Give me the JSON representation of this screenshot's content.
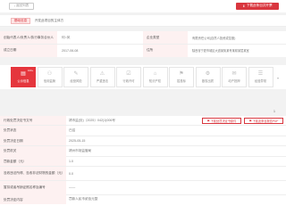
{
  "topbar": {
    "back_label": "返回列表",
    "apply_label": "下载此条目并开票",
    "back_icon": "arrow-left-icon",
    "apply_icon": "download-icon",
    "accent": "#d9363e"
  },
  "tabs": [
    {
      "label": "基础信息"
    },
    {
      "label": "开发此项目的主体方"
    }
  ],
  "info": {
    "rows": [
      {
        "label_a": "创始代表人/负责人/执行事务合伙人",
        "value_a": "何○凤",
        "label_b": "企业类型",
        "value_b": "有限责任公司(自然人投资或控股)"
      },
      {
        "label_a": "成立日期",
        "value_a": "2017-06-08",
        "label_b": "住所",
        "value_b": "陕西省宁夏市城区大道某街某号某幢某层某室"
      }
    ]
  },
  "icons": [
    {
      "label": "公示信息",
      "glyph": "▤",
      "name": "document-icon",
      "badge": "100+"
    },
    {
      "label": "信用监管",
      "glyph": "⚇",
      "name": "shield-icon"
    },
    {
      "label": "经营风险",
      "glyph": "✎",
      "name": "edit-icon"
    },
    {
      "label": "严重违法",
      "glyph": "⚠",
      "name": "warning-icon"
    },
    {
      "label": "行政许可",
      "glyph": "☑",
      "name": "check-icon"
    },
    {
      "label": "知识产权",
      "glyph": "⌂",
      "name": "building-icon"
    },
    {
      "label": "招投标",
      "glyph": "⚑",
      "name": "flag-icon"
    },
    {
      "label": "股权出质",
      "glyph": "⚙",
      "name": "gear-icon"
    },
    {
      "label": "动产抵押",
      "glyph": "✉",
      "name": "mail-icon"
    },
    {
      "label": "经营异常",
      "glyph": "☰",
      "name": "list-icon"
    }
  ],
  "page_number": "1",
  "detail": {
    "header_label": "行政处罚决定书文号",
    "header_value": "靖市监(处)〔2025〕042(1)006号",
    "buttons": [
      {
        "label": "下载处罚决定书原件"
      },
      {
        "label": "下载此条目报告PDF"
      }
    ],
    "rows": [
      {
        "label": "处罚状态",
        "value": "已结"
      },
      {
        "label": "处罚决定日期",
        "value": "2025-05-15"
      },
      {
        "label": "处罚机关",
        "value": "靖州市场监管局"
      },
      {
        "label": "罚款金额（元）",
        "value": "1.0"
      },
      {
        "label": "没收违法所得、没收非法财物的金额（元）",
        "value": "0.0"
      },
      {
        "label": "暂扣或者吊销证照名称及编号",
        "value": "——"
      },
      {
        "label": "处罚决定内容",
        "value": "罚款人民币贰佰元整"
      }
    ]
  }
}
